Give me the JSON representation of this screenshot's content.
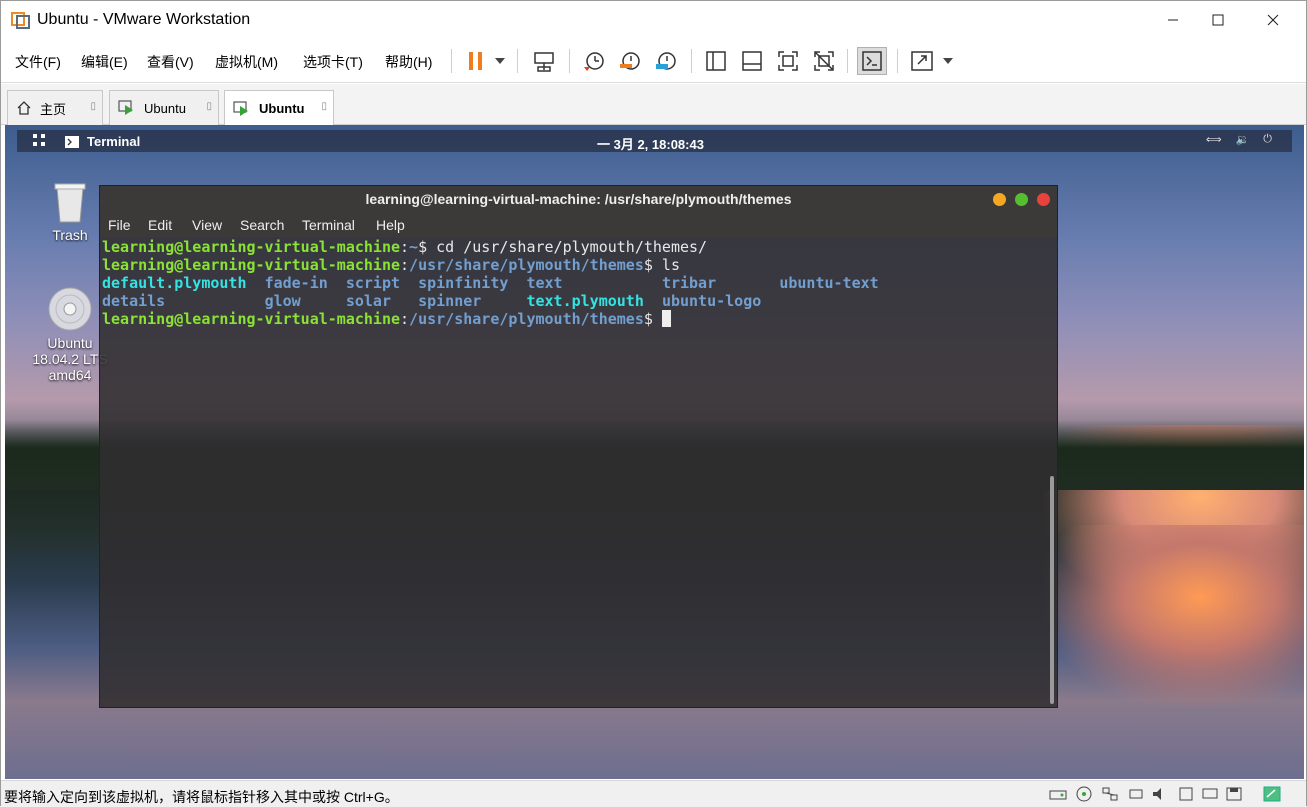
{
  "window": {
    "title": "Ubuntu - VMware Workstation",
    "minimize": "—",
    "maximize": "☐",
    "close": "✕"
  },
  "menu": {
    "file": "文件(F)",
    "edit": "编辑(E)",
    "view": "查看(V)",
    "vm": "虚拟机(M)",
    "tabs": "选项卡(T)",
    "help": "帮助(H)"
  },
  "tabs": [
    {
      "label": "主页",
      "icon": "home-icon"
    },
    {
      "label": "Ubuntu",
      "icon": "vm-play-icon"
    },
    {
      "label": "Ubuntu",
      "icon": "vm-play-icon",
      "active": true
    }
  ],
  "guest": {
    "topbar": {
      "app": "Terminal",
      "clock": "一 3月  2, 18:08:43"
    },
    "desktop_icons": [
      {
        "label": "Trash",
        "icon": "trash-icon"
      },
      {
        "label": "Ubuntu\n18.04.2 LTS\namd64",
        "icon": "disc-icon"
      }
    ],
    "terminal": {
      "title": "learning@learning-virtual-machine: /usr/share/plymouth/themes",
      "menu": [
        "File",
        "Edit",
        "View",
        "Search",
        "Terminal",
        "Help"
      ],
      "prompt_user": "learning@learning-virtual-machine",
      "line1_path": "~",
      "line1_cmd": "$ cd /usr/share/plymouth/themes/",
      "line2_path": "/usr/share/plymouth/themes",
      "line2_cmd": "$ ls",
      "ls_row1": [
        "default.plymouth",
        "fade-in",
        "script",
        "spinfinity",
        "text",
        "tribar",
        "ubuntu-text"
      ],
      "ls_row2": [
        "details",
        "glow",
        "solar",
        "spinner",
        "text.plymouth",
        "ubuntu-logo"
      ],
      "line3_path": "/usr/share/plymouth/themes",
      "line3_cmd": "$ "
    }
  },
  "status": {
    "message": "要将输入定向到该虚拟机，请将鼠标指针移入其中或按 Ctrl+G。"
  },
  "colors": {
    "prompt_green": "#8ae234",
    "path_blue": "#729fcf",
    "link_cyan": "#34e2e2",
    "pause_orange": "#f07c20"
  }
}
